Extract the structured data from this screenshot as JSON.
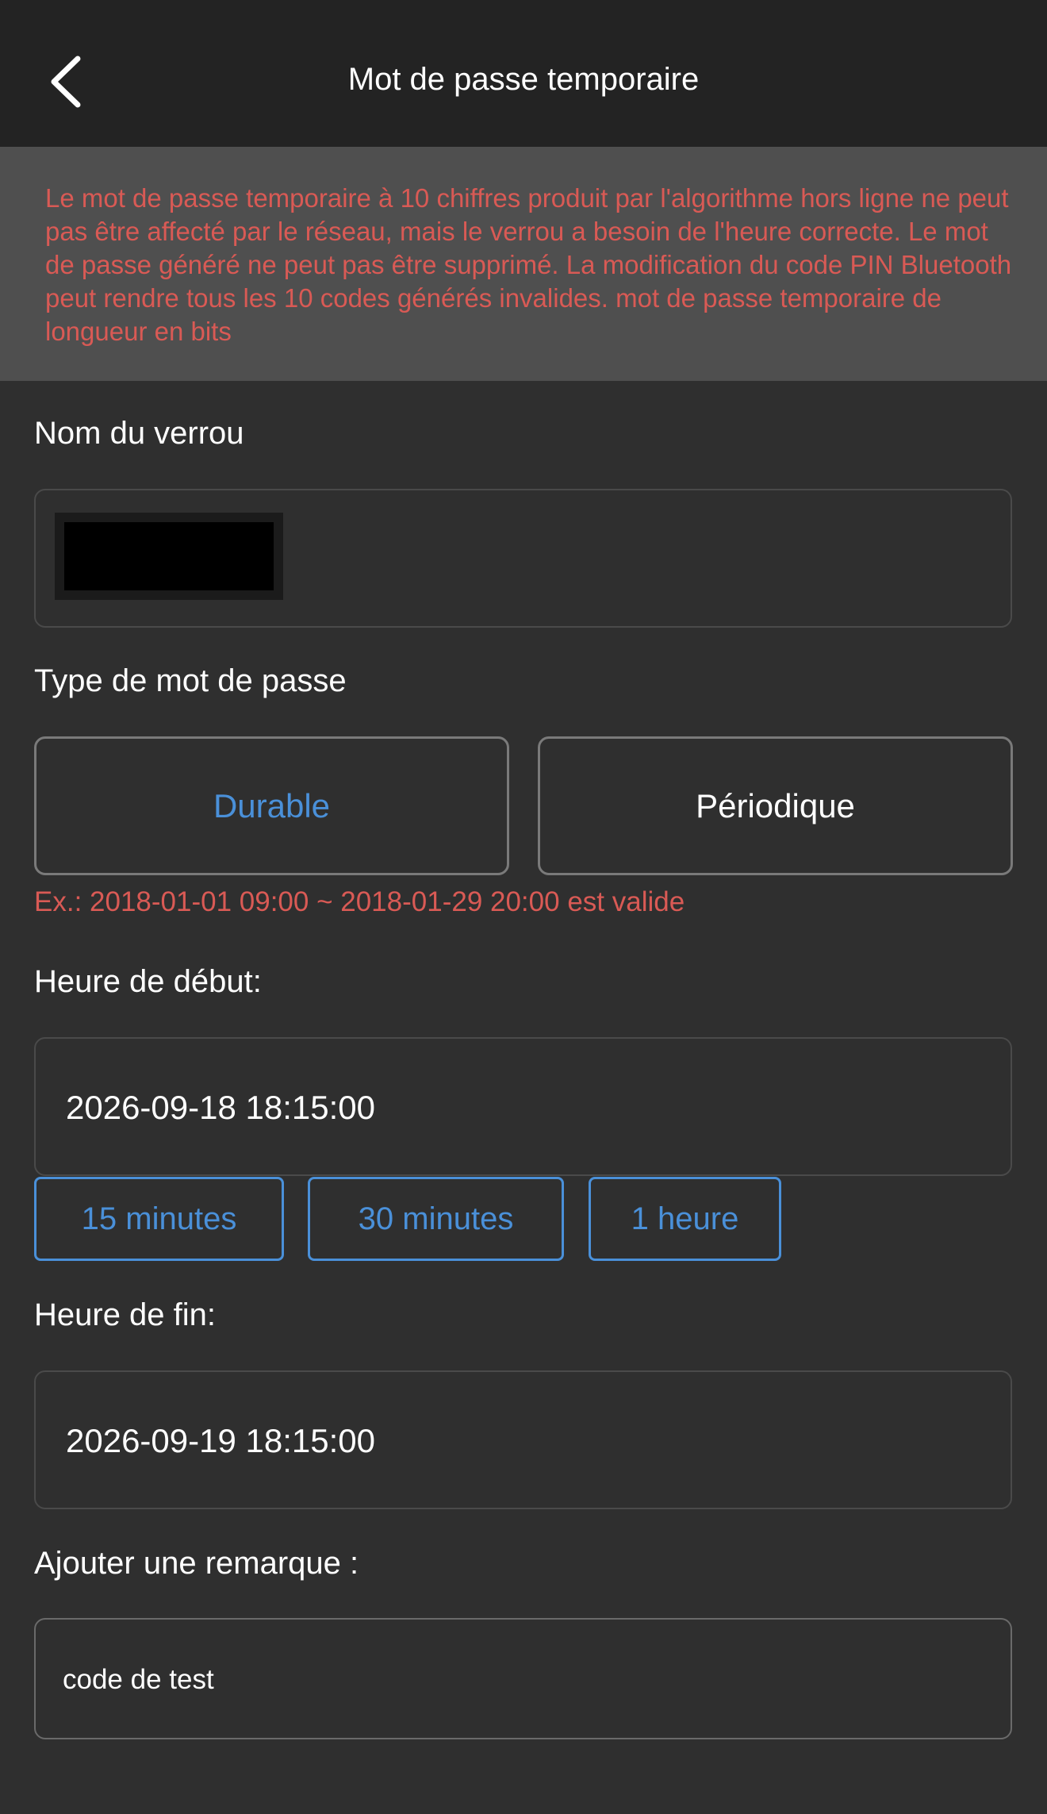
{
  "header": {
    "title": "Mot de passe temporaire",
    "back_icon": "chevron-left-icon"
  },
  "notice": {
    "text": "Le mot de passe temporaire à 10 chiffres produit par l'algorithme hors ligne ne peut pas être affecté par le réseau, mais le verrou a besoin de l'heure correcte. Le mot de passe généré ne peut pas être supprimé. La modification du code PIN Bluetooth peut rendre tous les 10 codes générés invalides. mot de passe temporaire de longueur en bits"
  },
  "lock_name": {
    "label": "Nom du verrou"
  },
  "password_type": {
    "label": "Type de mot de passe",
    "options": [
      {
        "label": "Durable",
        "selected": true
      },
      {
        "label": "Périodique",
        "selected": false
      }
    ],
    "hint": "Ex.: 2018-01-01 09:00 ~ 2018-01-29 20:00 est valide"
  },
  "start_time": {
    "label": "Heure de début:",
    "value": "2026-09-18 18:15:00",
    "quick_options": [
      "15 minutes",
      "30 minutes",
      "1 heure"
    ]
  },
  "end_time": {
    "label": "Heure de fin:",
    "value": "2026-09-19 18:15:00"
  },
  "remark": {
    "label": "Ajouter une remarque :",
    "value": "code de test"
  },
  "colors": {
    "background": "#2f2f2f",
    "header": "#232323",
    "notice_bg": "#4f4f4f",
    "warning": "#d95a55",
    "accent": "#4a90d9"
  }
}
